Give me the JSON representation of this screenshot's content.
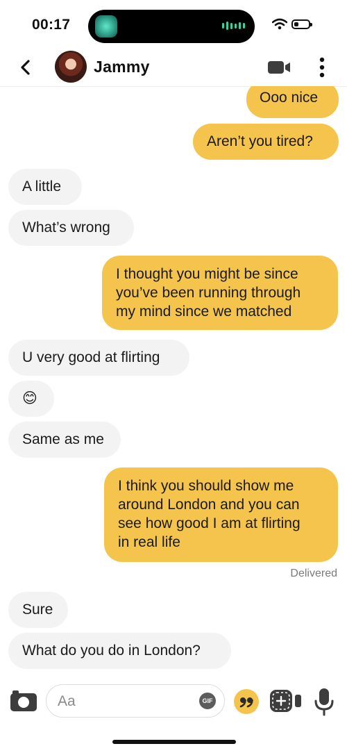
{
  "status_bar": {
    "time": "00:17"
  },
  "header": {
    "back_icon": "chevron-left-icon",
    "name": "Jammy",
    "video_icon": "video-camera-icon",
    "more_icon": "more-vertical-icon"
  },
  "messages": [
    {
      "dir": "out",
      "text": "Ooo nice"
    },
    {
      "dir": "out",
      "text": "Aren’t you tired?"
    },
    {
      "dir": "in",
      "text": "A little"
    },
    {
      "dir": "in",
      "text": "What’s wrong"
    },
    {
      "dir": "out",
      "text": "I thought you might be since\nyou’ve been running through\nmy mind since we matched"
    },
    {
      "dir": "in",
      "text": "U very good at flirting"
    },
    {
      "dir": "in",
      "text": "😊"
    },
    {
      "dir": "in",
      "text": "Same as me"
    },
    {
      "dir": "out",
      "text": "I think you should show me\naround London and you can\nsee how good I am at flirting\nin real life"
    },
    {
      "dir": "in",
      "text": "Sure"
    },
    {
      "dir": "in",
      "text": "What do you do in London?"
    }
  ],
  "delivered": "Delivered",
  "composer": {
    "placeholder": "Aa",
    "gif_label": "GIF"
  },
  "colors": {
    "outgoing": "#f5c44d",
    "incoming": "#f3f3f3",
    "accent_green": "#37d3a6"
  }
}
